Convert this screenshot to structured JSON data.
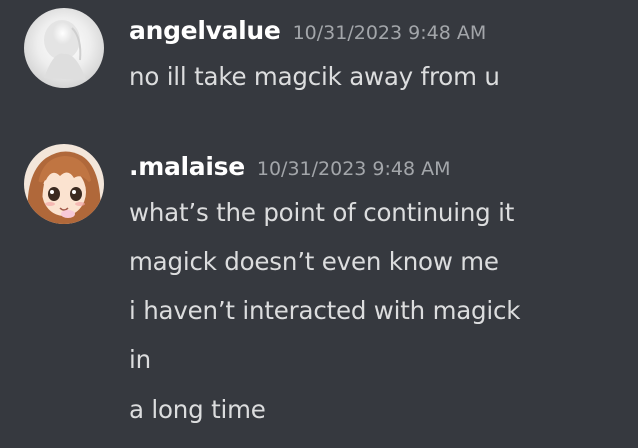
{
  "colors": {
    "background": "#36393f",
    "username": "#ffffff",
    "timestamp": "#a3a6aa",
    "message_text": "#dcddde"
  },
  "messages": [
    {
      "avatar_icon": "ghostly-white-figure-avatar-icon",
      "username": "angelvalue",
      "timestamp": "10/31/2023 9:48 AM",
      "lines": [
        "no ill take magcik away from u"
      ]
    },
    {
      "avatar_icon": "anime-girl-avatar-icon",
      "username": ".malaise",
      "timestamp": "10/31/2023 9:48 AM",
      "lines": [
        "what’s the point of continuing it",
        "magick doesn’t even know me",
        "i haven’t interacted with magick",
        "in",
        "a long time"
      ]
    }
  ]
}
